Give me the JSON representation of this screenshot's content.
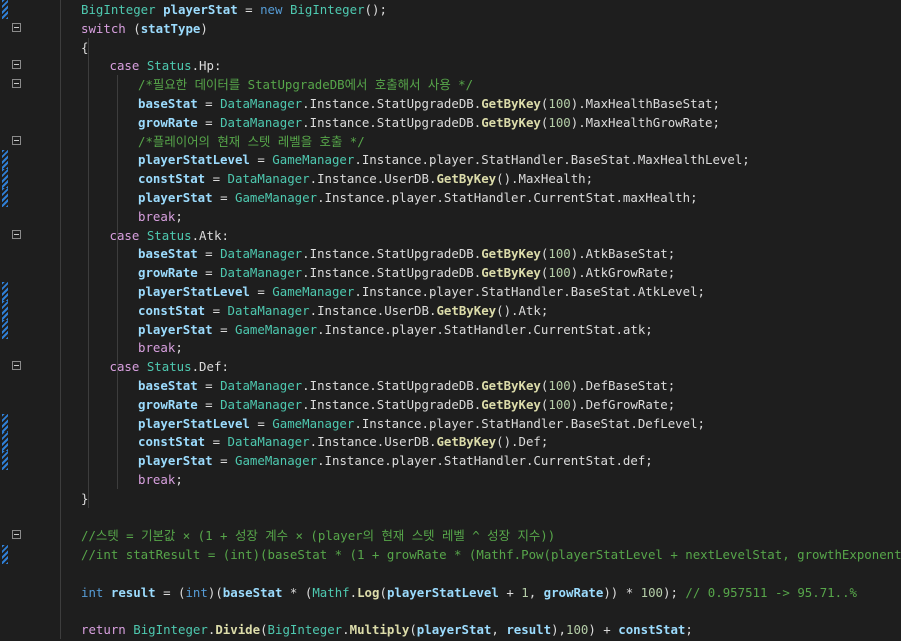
{
  "lines": [
    {
      "indent": 2,
      "tokens": [
        [
          "BigInteger",
          "type"
        ],
        [
          " ",
          "plain"
        ],
        [
          "playerStat",
          "var"
        ],
        [
          " = ",
          "plain"
        ],
        [
          "new",
          "kw2"
        ],
        [
          " ",
          "plain"
        ],
        [
          "BigInteger",
          "type"
        ],
        [
          "();",
          "plain"
        ]
      ],
      "mark": true
    },
    {
      "indent": 2,
      "tokens": [
        [
          "switch",
          "kw"
        ],
        [
          " (",
          "plain"
        ],
        [
          "statType",
          "var"
        ],
        [
          ")",
          "plain"
        ]
      ],
      "fold": true
    },
    {
      "indent": 2,
      "tokens": [
        [
          "{",
          "plain"
        ]
      ]
    },
    {
      "indent": 3,
      "tokens": [
        [
          "case",
          "kw"
        ],
        [
          " ",
          "plain"
        ],
        [
          "Status",
          "type"
        ],
        [
          ".",
          "plain"
        ],
        [
          "Hp",
          "plain"
        ],
        [
          ":",
          "plain"
        ]
      ],
      "fold": true
    },
    {
      "indent": 4,
      "tokens": [
        [
          "/*필요한 데이터를 StatUpgradeDB에서 호출해서 사용 */",
          "cmt"
        ]
      ],
      "fold": true
    },
    {
      "indent": 4,
      "tokens": [
        [
          "baseStat",
          "var"
        ],
        [
          " = ",
          "plain"
        ],
        [
          "DataManager",
          "type"
        ],
        [
          ".",
          "plain"
        ],
        [
          "Instance",
          "plain"
        ],
        [
          ".StatUpgradeDB.",
          "plain"
        ],
        [
          "GetByKey",
          "fn"
        ],
        [
          "(",
          "plain"
        ],
        [
          "100",
          "num"
        ],
        [
          ").MaxHealthBaseStat;",
          "plain"
        ]
      ]
    },
    {
      "indent": 4,
      "tokens": [
        [
          "growRate",
          "var"
        ],
        [
          " = ",
          "plain"
        ],
        [
          "DataManager",
          "type"
        ],
        [
          ".",
          "plain"
        ],
        [
          "Instance",
          "plain"
        ],
        [
          ".StatUpgradeDB.",
          "plain"
        ],
        [
          "GetByKey",
          "fn"
        ],
        [
          "(",
          "plain"
        ],
        [
          "100",
          "num"
        ],
        [
          ").MaxHealthGrowRate;",
          "plain"
        ]
      ]
    },
    {
      "indent": 4,
      "tokens": [
        [
          "/*플레이어의 현재 스텟 레벨을 호출 */",
          "cmt"
        ]
      ],
      "fold": true
    },
    {
      "indent": 4,
      "tokens": [
        [
          "playerStatLevel",
          "var"
        ],
        [
          " = ",
          "plain"
        ],
        [
          "GameManager",
          "type"
        ],
        [
          ".",
          "plain"
        ],
        [
          "Instance",
          "plain"
        ],
        [
          ".player.StatHandler.BaseStat.MaxHealthLevel;",
          "plain"
        ]
      ],
      "mark": true
    },
    {
      "indent": 4,
      "tokens": [
        [
          "constStat",
          "var"
        ],
        [
          " = ",
          "plain"
        ],
        [
          "DataManager",
          "type"
        ],
        [
          ".",
          "plain"
        ],
        [
          "Instance",
          "plain"
        ],
        [
          ".UserDB.",
          "plain"
        ],
        [
          "GetByKey",
          "fn"
        ],
        [
          "().MaxHealth;",
          "plain"
        ]
      ],
      "mark": true
    },
    {
      "indent": 4,
      "tokens": [
        [
          "playerStat",
          "var"
        ],
        [
          " = ",
          "plain"
        ],
        [
          "GameManager",
          "type"
        ],
        [
          ".",
          "plain"
        ],
        [
          "Instance",
          "plain"
        ],
        [
          ".player.StatHandler.CurrentStat.maxHealth;",
          "plain"
        ]
      ],
      "mark": true
    },
    {
      "indent": 4,
      "tokens": [
        [
          "break",
          "kw"
        ],
        [
          ";",
          "plain"
        ]
      ]
    },
    {
      "indent": 3,
      "tokens": [
        [
          "case",
          "kw"
        ],
        [
          " ",
          "plain"
        ],
        [
          "Status",
          "type"
        ],
        [
          ".",
          "plain"
        ],
        [
          "Atk",
          "plain"
        ],
        [
          ":",
          "plain"
        ]
      ],
      "fold": true
    },
    {
      "indent": 4,
      "tokens": [
        [
          "baseStat",
          "var"
        ],
        [
          " = ",
          "plain"
        ],
        [
          "DataManager",
          "type"
        ],
        [
          ".",
          "plain"
        ],
        [
          "Instance",
          "plain"
        ],
        [
          ".StatUpgradeDB.",
          "plain"
        ],
        [
          "GetByKey",
          "fn"
        ],
        [
          "(",
          "plain"
        ],
        [
          "100",
          "num"
        ],
        [
          ").AtkBaseStat;",
          "plain"
        ]
      ]
    },
    {
      "indent": 4,
      "tokens": [
        [
          "growRate",
          "var"
        ],
        [
          " = ",
          "plain"
        ],
        [
          "DataManager",
          "type"
        ],
        [
          ".",
          "plain"
        ],
        [
          "Instance",
          "plain"
        ],
        [
          ".StatUpgradeDB.",
          "plain"
        ],
        [
          "GetByKey",
          "fn"
        ],
        [
          "(",
          "plain"
        ],
        [
          "100",
          "num"
        ],
        [
          ").AtkGrowRate;",
          "plain"
        ]
      ]
    },
    {
      "indent": 4,
      "tokens": [
        [
          "playerStatLevel",
          "var"
        ],
        [
          " = ",
          "plain"
        ],
        [
          "GameManager",
          "type"
        ],
        [
          ".",
          "plain"
        ],
        [
          "Instance",
          "plain"
        ],
        [
          ".player.StatHandler.BaseStat.AtkLevel;",
          "plain"
        ]
      ],
      "mark": true
    },
    {
      "indent": 4,
      "tokens": [
        [
          "constStat",
          "var"
        ],
        [
          " = ",
          "plain"
        ],
        [
          "DataManager",
          "type"
        ],
        [
          ".",
          "plain"
        ],
        [
          "Instance",
          "plain"
        ],
        [
          ".UserDB.",
          "plain"
        ],
        [
          "GetByKey",
          "fn"
        ],
        [
          "().Atk;",
          "plain"
        ]
      ],
      "mark": true
    },
    {
      "indent": 4,
      "tokens": [
        [
          "playerStat",
          "var"
        ],
        [
          " = ",
          "plain"
        ],
        [
          "GameManager",
          "type"
        ],
        [
          ".",
          "plain"
        ],
        [
          "Instance",
          "plain"
        ],
        [
          ".player.StatHandler.CurrentStat.atk;",
          "plain"
        ]
      ],
      "mark": true
    },
    {
      "indent": 4,
      "tokens": [
        [
          "break",
          "kw"
        ],
        [
          ";",
          "plain"
        ]
      ]
    },
    {
      "indent": 3,
      "tokens": [
        [
          "case",
          "kw"
        ],
        [
          " ",
          "plain"
        ],
        [
          "Status",
          "type"
        ],
        [
          ".",
          "plain"
        ],
        [
          "Def",
          "plain"
        ],
        [
          ":",
          "plain"
        ]
      ],
      "fold": true
    },
    {
      "indent": 4,
      "tokens": [
        [
          "baseStat",
          "var"
        ],
        [
          " = ",
          "plain"
        ],
        [
          "DataManager",
          "type"
        ],
        [
          ".",
          "plain"
        ],
        [
          "Instance",
          "plain"
        ],
        [
          ".StatUpgradeDB.",
          "plain"
        ],
        [
          "GetByKey",
          "fn"
        ],
        [
          "(",
          "plain"
        ],
        [
          "100",
          "num"
        ],
        [
          ").DefBaseStat;",
          "plain"
        ]
      ]
    },
    {
      "indent": 4,
      "tokens": [
        [
          "growRate",
          "var"
        ],
        [
          " = ",
          "plain"
        ],
        [
          "DataManager",
          "type"
        ],
        [
          ".",
          "plain"
        ],
        [
          "Instance",
          "plain"
        ],
        [
          ".StatUpgradeDB.",
          "plain"
        ],
        [
          "GetByKey",
          "fn"
        ],
        [
          "(",
          "plain"
        ],
        [
          "100",
          "num"
        ],
        [
          ").DefGrowRate;",
          "plain"
        ]
      ]
    },
    {
      "indent": 4,
      "tokens": [
        [
          "playerStatLevel",
          "var"
        ],
        [
          " = ",
          "plain"
        ],
        [
          "GameManager",
          "type"
        ],
        [
          ".",
          "plain"
        ],
        [
          "Instance",
          "plain"
        ],
        [
          ".player.StatHandler.BaseStat.DefLevel;",
          "plain"
        ]
      ],
      "mark": true
    },
    {
      "indent": 4,
      "tokens": [
        [
          "constStat",
          "var"
        ],
        [
          " = ",
          "plain"
        ],
        [
          "DataManager",
          "type"
        ],
        [
          ".",
          "plain"
        ],
        [
          "Instance",
          "plain"
        ],
        [
          ".UserDB.",
          "plain"
        ],
        [
          "GetByKey",
          "fn"
        ],
        [
          "().Def;",
          "plain"
        ]
      ],
      "mark": true
    },
    {
      "indent": 4,
      "tokens": [
        [
          "playerStat",
          "var"
        ],
        [
          " = ",
          "plain"
        ],
        [
          "GameManager",
          "type"
        ],
        [
          ".",
          "plain"
        ],
        [
          "Instance",
          "plain"
        ],
        [
          ".player.StatHandler.CurrentStat.def;",
          "plain"
        ]
      ],
      "mark": true
    },
    {
      "indent": 4,
      "tokens": [
        [
          "break",
          "kw"
        ],
        [
          ";",
          "plain"
        ]
      ]
    },
    {
      "indent": 2,
      "tokens": [
        [
          "}",
          "plain"
        ]
      ]
    },
    {
      "indent": 2,
      "tokens": []
    },
    {
      "indent": 2,
      "tokens": [
        [
          "//스텟 = 기본값 × (1 + 성장 계수 × (player의 현재 스텟 레벨 ^ 성장 지수))",
          "cmt"
        ]
      ],
      "fold": true
    },
    {
      "indent": 2,
      "tokens": [
        [
          "//int statResult = (int)(baseStat * (1 + growRate * (Mathf.Pow(playerStatLevel + nextLevelStat, growthExponent))));",
          "cmt"
        ]
      ],
      "mark": true
    },
    {
      "indent": 2,
      "tokens": []
    },
    {
      "indent": 2,
      "tokens": [
        [
          "int",
          "kw2"
        ],
        [
          " ",
          "plain"
        ],
        [
          "result",
          "var"
        ],
        [
          " = (",
          "plain"
        ],
        [
          "int",
          "kw2"
        ],
        [
          ")(",
          "plain"
        ],
        [
          "baseStat",
          "var"
        ],
        [
          " * (",
          "plain"
        ],
        [
          "Mathf",
          "type"
        ],
        [
          ".",
          "plain"
        ],
        [
          "Log",
          "fn"
        ],
        [
          "(",
          "plain"
        ],
        [
          "playerStatLevel",
          "var"
        ],
        [
          " + ",
          "plain"
        ],
        [
          "1",
          "num"
        ],
        [
          ", ",
          "plain"
        ],
        [
          "growRate",
          "var"
        ],
        [
          ")) * ",
          "plain"
        ],
        [
          "100",
          "num"
        ],
        [
          "); ",
          "plain"
        ],
        [
          "// 0.957511 -> 95.71..%",
          "cmt"
        ]
      ]
    },
    {
      "indent": 2,
      "tokens": []
    },
    {
      "indent": 2,
      "tokens": [
        [
          "return",
          "kw"
        ],
        [
          " ",
          "plain"
        ],
        [
          "BigInteger",
          "type"
        ],
        [
          ".",
          "plain"
        ],
        [
          "Divide",
          "fn"
        ],
        [
          "(",
          "plain"
        ],
        [
          "BigInteger",
          "type"
        ],
        [
          ".",
          "plain"
        ],
        [
          "Multiply",
          "fn"
        ],
        [
          "(",
          "plain"
        ],
        [
          "playerStat",
          "var"
        ],
        [
          ", ",
          "plain"
        ],
        [
          "result",
          "var"
        ],
        [
          "),",
          "plain"
        ],
        [
          "100",
          "num"
        ],
        [
          ") + ",
          "plain"
        ],
        [
          "constStat",
          "var"
        ],
        [
          ";",
          "plain"
        ]
      ]
    }
  ]
}
